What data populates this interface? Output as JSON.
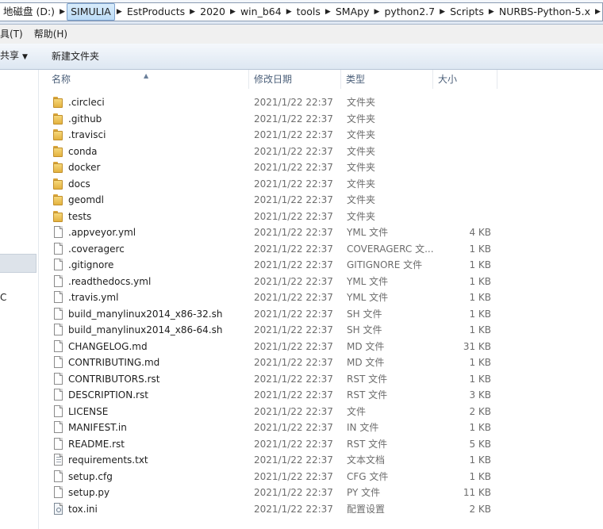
{
  "address_bar": {
    "crumbs": [
      "地磁盘 (D:)",
      "SIMULIA",
      "EstProducts",
      "2020",
      "win_b64",
      "tools",
      "SMApy",
      "python2.7",
      "Scripts",
      "NURBS-Python-5.x"
    ],
    "separator": "▶"
  },
  "menu": {
    "items": [
      "具(T)",
      "帮助(H)"
    ]
  },
  "toolbar": {
    "share_label": "共享",
    "share_caret": "▼",
    "new_folder_label": "新建文件夹"
  },
  "nav": {
    "partial_item": "C"
  },
  "columns": {
    "name": "名称",
    "date": "修改日期",
    "type": "类型",
    "size": "大小",
    "sort_indicator": "▲"
  },
  "files": [
    {
      "name": ".circleci",
      "date": "2021/1/22 22:37",
      "type": "文件夹",
      "size": "",
      "icon": "folder-icon"
    },
    {
      "name": ".github",
      "date": "2021/1/22 22:37",
      "type": "文件夹",
      "size": "",
      "icon": "folder-icon"
    },
    {
      "name": ".travisci",
      "date": "2021/1/22 22:37",
      "type": "文件夹",
      "size": "",
      "icon": "folder-icon"
    },
    {
      "name": "conda",
      "date": "2021/1/22 22:37",
      "type": "文件夹",
      "size": "",
      "icon": "folder-icon"
    },
    {
      "name": "docker",
      "date": "2021/1/22 22:37",
      "type": "文件夹",
      "size": "",
      "icon": "folder-icon"
    },
    {
      "name": "docs",
      "date": "2021/1/22 22:37",
      "type": "文件夹",
      "size": "",
      "icon": "folder-icon"
    },
    {
      "name": "geomdl",
      "date": "2021/1/22 22:37",
      "type": "文件夹",
      "size": "",
      "icon": "folder-icon"
    },
    {
      "name": "tests",
      "date": "2021/1/22 22:37",
      "type": "文件夹",
      "size": "",
      "icon": "folder-icon"
    },
    {
      "name": ".appveyor.yml",
      "date": "2021/1/22 22:37",
      "type": "YML 文件",
      "size": "4 KB",
      "icon": "file-icon"
    },
    {
      "name": ".coveragerc",
      "date": "2021/1/22 22:37",
      "type": "COVERAGERC 文...",
      "size": "1 KB",
      "icon": "file-icon"
    },
    {
      "name": ".gitignore",
      "date": "2021/1/22 22:37",
      "type": "GITIGNORE 文件",
      "size": "1 KB",
      "icon": "file-icon"
    },
    {
      "name": ".readthedocs.yml",
      "date": "2021/1/22 22:37",
      "type": "YML 文件",
      "size": "1 KB",
      "icon": "file-icon"
    },
    {
      "name": ".travis.yml",
      "date": "2021/1/22 22:37",
      "type": "YML 文件",
      "size": "1 KB",
      "icon": "file-icon"
    },
    {
      "name": "build_manylinux2014_x86-32.sh",
      "date": "2021/1/22 22:37",
      "type": "SH 文件",
      "size": "1 KB",
      "icon": "file-icon"
    },
    {
      "name": "build_manylinux2014_x86-64.sh",
      "date": "2021/1/22 22:37",
      "type": "SH 文件",
      "size": "1 KB",
      "icon": "file-icon"
    },
    {
      "name": "CHANGELOG.md",
      "date": "2021/1/22 22:37",
      "type": "MD 文件",
      "size": "31 KB",
      "icon": "file-icon"
    },
    {
      "name": "CONTRIBUTING.md",
      "date": "2021/1/22 22:37",
      "type": "MD 文件",
      "size": "1 KB",
      "icon": "file-icon"
    },
    {
      "name": "CONTRIBUTORS.rst",
      "date": "2021/1/22 22:37",
      "type": "RST 文件",
      "size": "1 KB",
      "icon": "file-icon"
    },
    {
      "name": "DESCRIPTION.rst",
      "date": "2021/1/22 22:37",
      "type": "RST 文件",
      "size": "3 KB",
      "icon": "file-icon"
    },
    {
      "name": "LICENSE",
      "date": "2021/1/22 22:37",
      "type": "文件",
      "size": "2 KB",
      "icon": "file-icon"
    },
    {
      "name": "MANIFEST.in",
      "date": "2021/1/22 22:37",
      "type": "IN 文件",
      "size": "1 KB",
      "icon": "file-icon"
    },
    {
      "name": "README.rst",
      "date": "2021/1/22 22:37",
      "type": "RST 文件",
      "size": "5 KB",
      "icon": "file-icon"
    },
    {
      "name": "requirements.txt",
      "date": "2021/1/22 22:37",
      "type": "文本文档",
      "size": "1 KB",
      "icon": "text-document-icon"
    },
    {
      "name": "setup.cfg",
      "date": "2021/1/22 22:37",
      "type": "CFG 文件",
      "size": "1 KB",
      "icon": "file-icon"
    },
    {
      "name": "setup.py",
      "date": "2021/1/22 22:37",
      "type": "PY 文件",
      "size": "11 KB",
      "icon": "file-icon"
    },
    {
      "name": "tox.ini",
      "date": "2021/1/22 22:37",
      "type": "配置设置",
      "size": "2 KB",
      "icon": "settings-file-icon"
    }
  ]
}
